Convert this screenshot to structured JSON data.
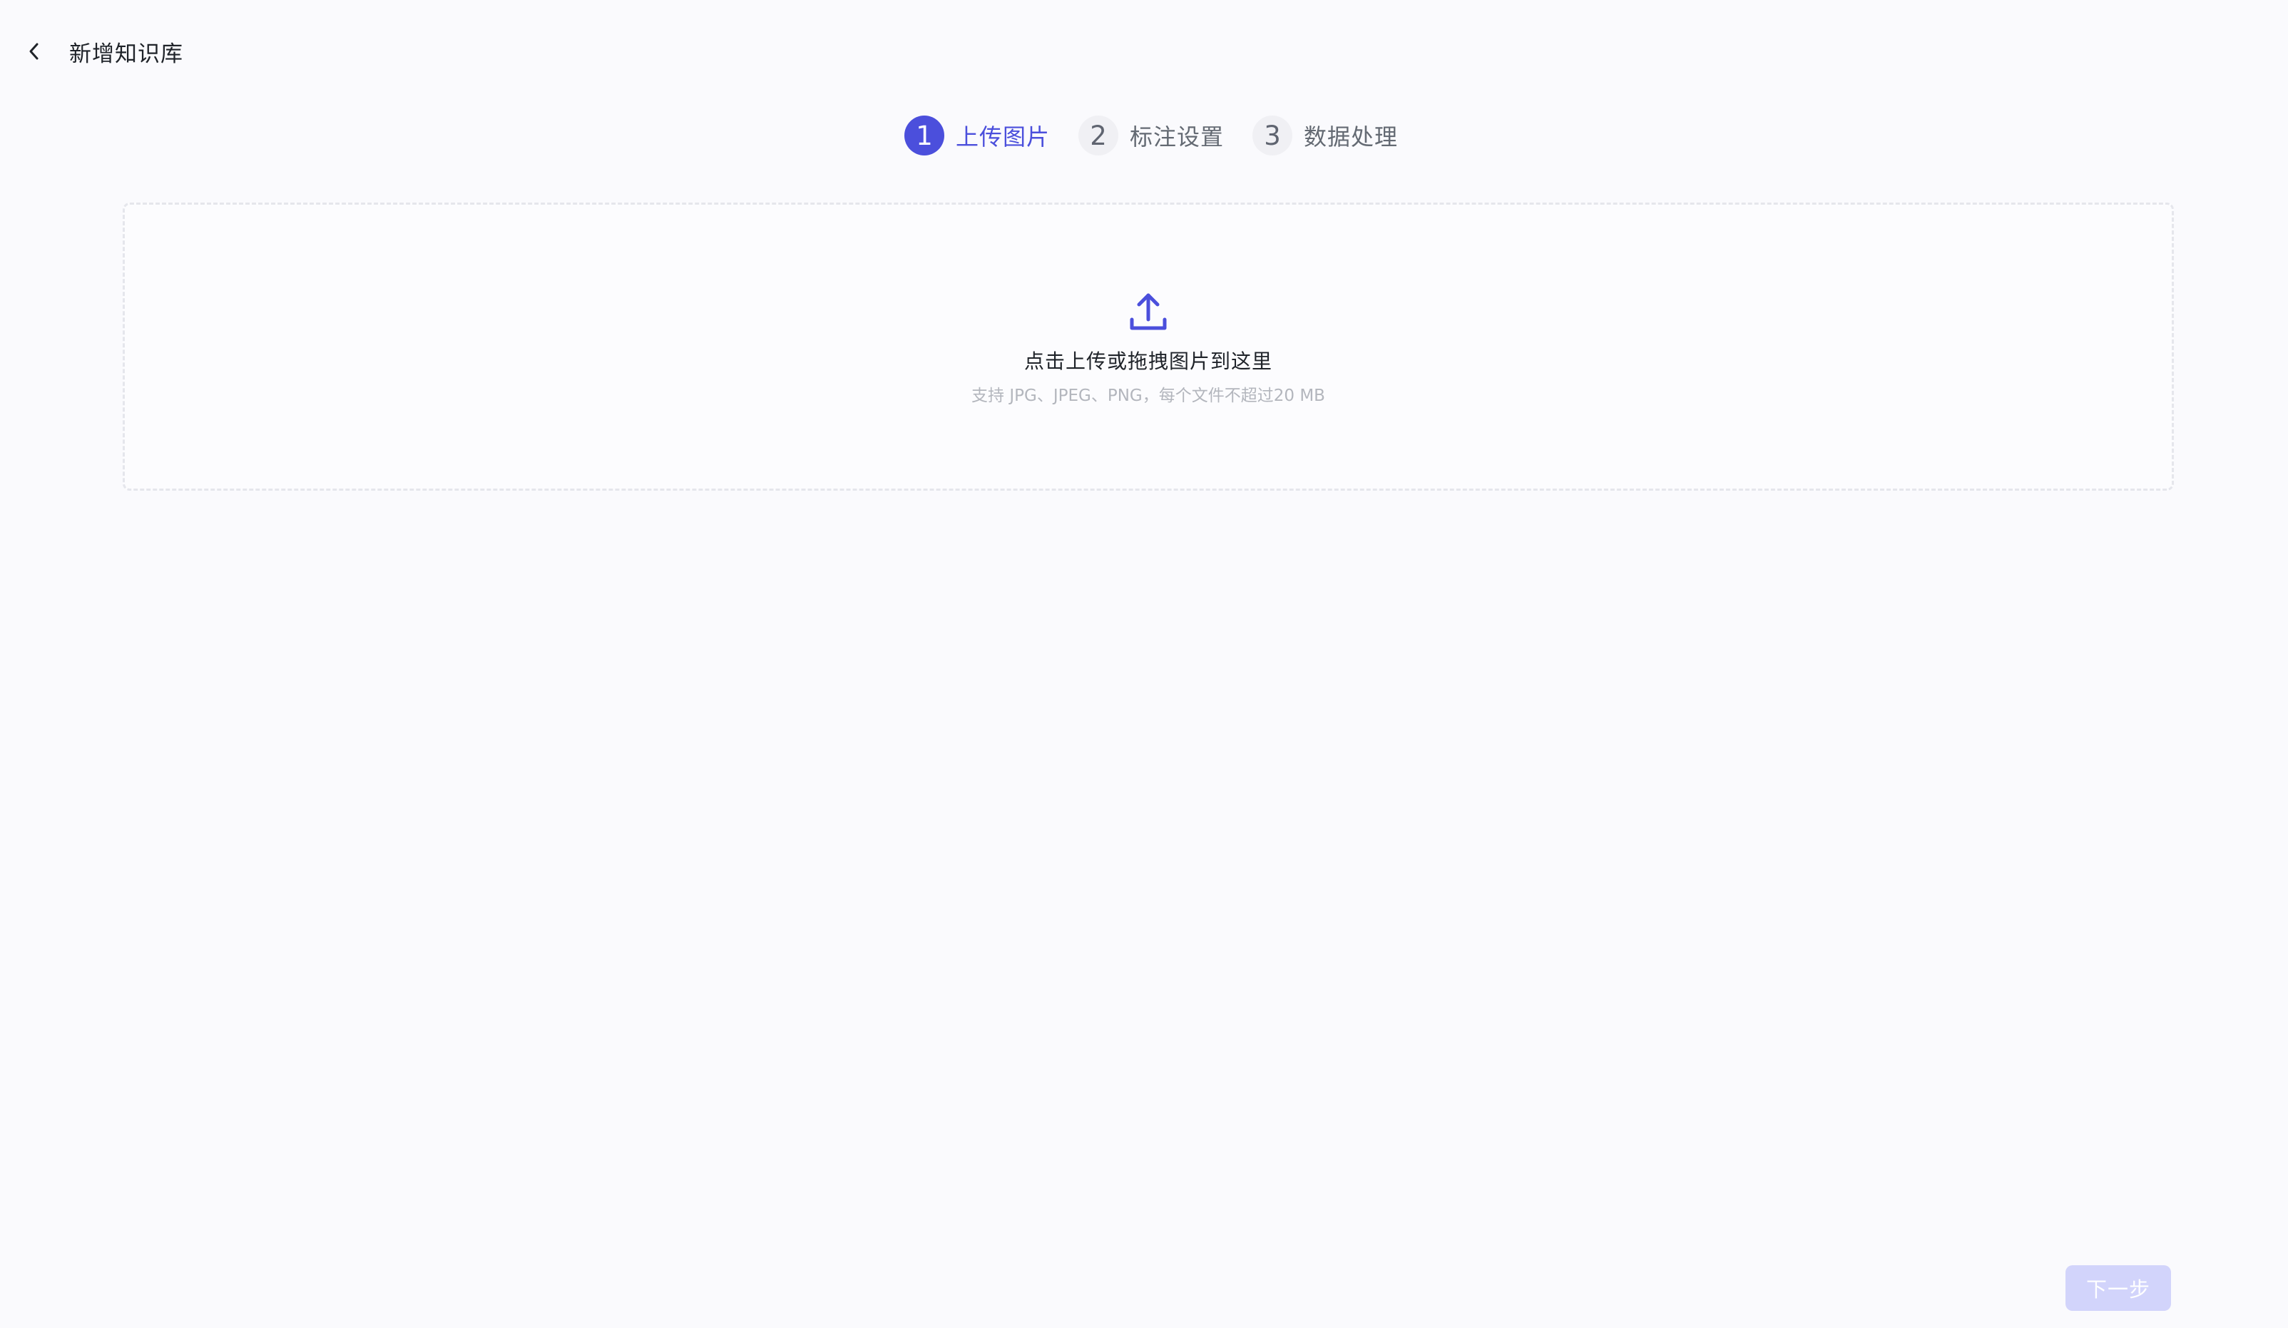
{
  "header": {
    "back_icon": "chevron-left-icon",
    "title": "新增知识库"
  },
  "steps": [
    {
      "number": "1",
      "label": "上传图片",
      "active": true
    },
    {
      "number": "2",
      "label": "标注设置",
      "active": false
    },
    {
      "number": "3",
      "label": "数据处理",
      "active": false
    }
  ],
  "upload": {
    "icon": "upload-icon",
    "title": "点击上传或拖拽图片到这里",
    "hint": "支持 JPG、JPEG、PNG，每个文件不超过20 MB"
  },
  "footer": {
    "next_label": "下一步",
    "next_disabled": true
  },
  "colors": {
    "accent": "#4b4fdc",
    "background": "#fafafd",
    "disabled_button": "#d2d4fb"
  }
}
